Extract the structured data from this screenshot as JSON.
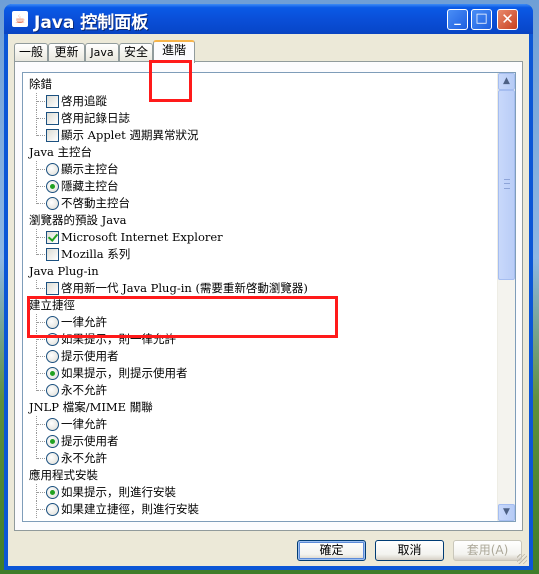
{
  "window": {
    "title": "Java 控制面板",
    "icon": "java-cup-icon",
    "controls": {
      "minimize": "_",
      "maximize": "□",
      "close": "✕"
    }
  },
  "tabs": [
    {
      "label": "一般"
    },
    {
      "label": "更新"
    },
    {
      "label": "Java"
    },
    {
      "label": "安全"
    },
    {
      "label": "進階",
      "selected": true
    }
  ],
  "tree": [
    {
      "type": "category",
      "label": "除錯"
    },
    {
      "type": "checkbox",
      "label": "啓用追蹤",
      "checked": false
    },
    {
      "type": "checkbox",
      "label": "啓用記錄日誌",
      "checked": false
    },
    {
      "type": "checkbox",
      "label": "顯示 Applet 週期異常狀況",
      "checked": false,
      "last": true
    },
    {
      "type": "category",
      "label": "Java 主控台"
    },
    {
      "type": "radio",
      "label": "顯示主控台",
      "checked": false
    },
    {
      "type": "radio",
      "label": "隱藏主控台",
      "checked": true
    },
    {
      "type": "radio",
      "label": "不啓動主控台",
      "checked": false,
      "last": true
    },
    {
      "type": "category",
      "label": "瀏覽器的預設 Java"
    },
    {
      "type": "checkbox",
      "label": "Microsoft Internet Explorer",
      "checked": true
    },
    {
      "type": "checkbox",
      "label": "Mozilla 系列",
      "checked": false,
      "last": true
    },
    {
      "type": "category",
      "label": "Java Plug-in"
    },
    {
      "type": "checkbox",
      "label": "啓用新一代 Java Plug-in (需要重新啓動瀏覽器)",
      "checked": false,
      "last": true
    },
    {
      "type": "category",
      "label": "建立捷徑"
    },
    {
      "type": "radio",
      "label": "一律允許",
      "checked": false
    },
    {
      "type": "radio",
      "label": "如果提示，則一律允許",
      "checked": false
    },
    {
      "type": "radio",
      "label": "提示使用者",
      "checked": false
    },
    {
      "type": "radio",
      "label": "如果提示，則提示使用者",
      "checked": true
    },
    {
      "type": "radio",
      "label": "永不允許",
      "checked": false,
      "last": true
    },
    {
      "type": "category",
      "label": "JNLP 檔案/MIME 關聯"
    },
    {
      "type": "radio",
      "label": "一律允許",
      "checked": false
    },
    {
      "type": "radio",
      "label": "提示使用者",
      "checked": true
    },
    {
      "type": "radio",
      "label": "永不允許",
      "checked": false,
      "last": true
    },
    {
      "type": "category",
      "label": "應用程式安裝"
    },
    {
      "type": "radio",
      "label": "如果提示，則進行安裝",
      "checked": true
    },
    {
      "type": "radio",
      "label": "如果建立捷徑，則進行安裝",
      "checked": false
    }
  ],
  "buttons": {
    "ok": "確定",
    "cancel": "取消",
    "apply": "套用(A)"
  },
  "scrollbar": {
    "up": "▲",
    "down": "▼"
  },
  "colors": {
    "titlebar": "#0a4fd8",
    "highlight": "#ff1a1a",
    "checked": "#21a121"
  }
}
